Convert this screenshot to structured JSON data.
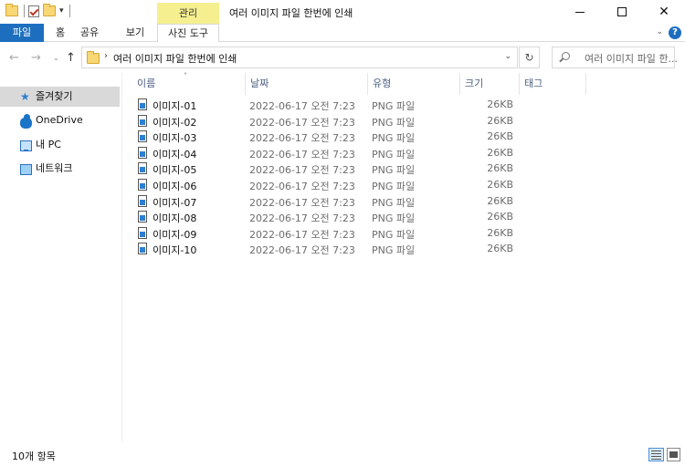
{
  "window": {
    "title": "여러 이미지 파일 한번에 인쇄",
    "context_tab_group": "관리",
    "controls": {
      "minimize": "—",
      "maximize": "□",
      "close": "✕"
    }
  },
  "quick_access_toolbar": {
    "dropdown": "▾"
  },
  "ribbon": {
    "tabs": [
      {
        "label": "파일"
      },
      {
        "label": "홈"
      },
      {
        "label": "공유"
      },
      {
        "label": "보기"
      },
      {
        "label": "사진 도구"
      }
    ],
    "expand_chevron": "⌄",
    "help": "?"
  },
  "navigation": {
    "back": "←",
    "forward": "→",
    "recent": "⌄",
    "up": "↑",
    "address": {
      "separator": "›",
      "path": "여러 이미지 파일 한번에 인쇄",
      "dropdown": "⌄"
    },
    "refresh": "↻",
    "search": {
      "placeholder": "여러 이미지 파일 한..."
    }
  },
  "sidebar": {
    "items": [
      {
        "label": "즐겨찾기",
        "icon": "star-icon",
        "selected": true
      },
      {
        "label": "OneDrive",
        "icon": "cloud-icon"
      },
      {
        "label": "내 PC",
        "icon": "pc-icon"
      },
      {
        "label": "네트워크",
        "icon": "network-icon"
      }
    ]
  },
  "file_list": {
    "sort_indicator": "˄",
    "columns": [
      "이름",
      "날짜",
      "유형",
      "크기",
      "태그"
    ],
    "rows": [
      {
        "name": "이미지-01",
        "date": "2022-06-17 오전 7:23",
        "type": "PNG 파일",
        "size": "26KB"
      },
      {
        "name": "이미지-02",
        "date": "2022-06-17 오전 7:23",
        "type": "PNG 파일",
        "size": "26KB"
      },
      {
        "name": "이미지-03",
        "date": "2022-06-17 오전 7:23",
        "type": "PNG 파일",
        "size": "26KB"
      },
      {
        "name": "이미지-04",
        "date": "2022-06-17 오전 7:23",
        "type": "PNG 파일",
        "size": "26KB"
      },
      {
        "name": "이미지-05",
        "date": "2022-06-17 오전 7:23",
        "type": "PNG 파일",
        "size": "26KB"
      },
      {
        "name": "이미지-06",
        "date": "2022-06-17 오전 7:23",
        "type": "PNG 파일",
        "size": "26KB"
      },
      {
        "name": "이미지-07",
        "date": "2022-06-17 오전 7:23",
        "type": "PNG 파일",
        "size": "26KB"
      },
      {
        "name": "이미지-08",
        "date": "2022-06-17 오전 7:23",
        "type": "PNG 파일",
        "size": "26KB"
      },
      {
        "name": "이미지-09",
        "date": "2022-06-17 오전 7:23",
        "type": "PNG 파일",
        "size": "26KB"
      },
      {
        "name": "이미지-10",
        "date": "2022-06-17 오전 7:23",
        "type": "PNG 파일",
        "size": "26KB"
      }
    ]
  },
  "status_bar": {
    "item_count": "10개 항목"
  }
}
